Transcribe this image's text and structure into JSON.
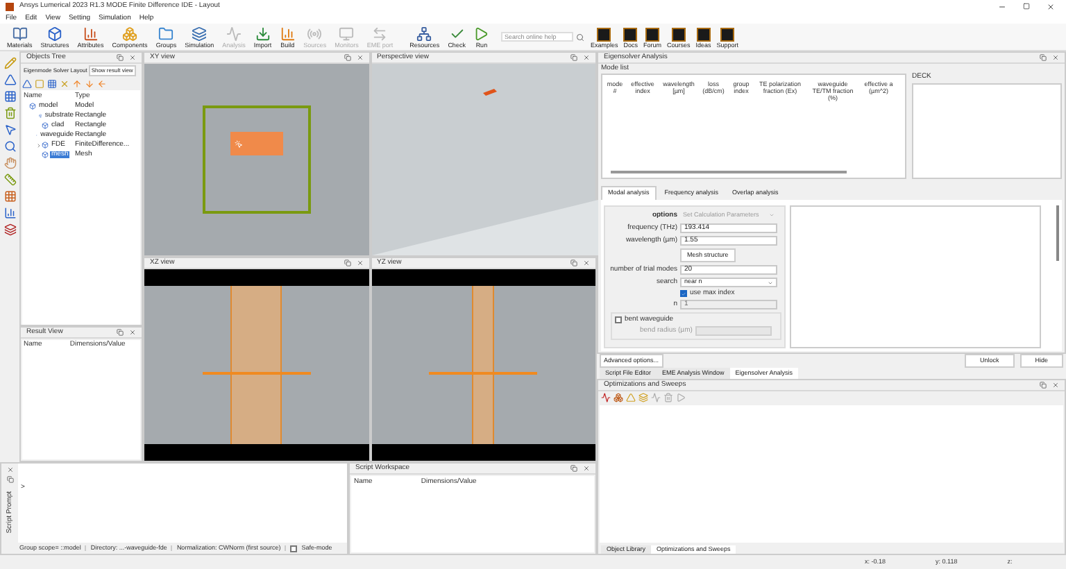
{
  "window": {
    "title": "Ansys Lumerical 2023 R1.3 MODE Finite Difference IDE - Layout"
  },
  "menu": [
    "File",
    "Edit",
    "View",
    "Setting",
    "Simulation",
    "Help"
  ],
  "toolbar": [
    {
      "label": "Materials",
      "disabled": false
    },
    {
      "label": "Structures",
      "disabled": false
    },
    {
      "label": "Attributes",
      "disabled": false
    },
    {
      "label": "Components",
      "disabled": false
    },
    {
      "label": "Groups",
      "disabled": false
    },
    {
      "label": "Simulation",
      "disabled": false
    },
    {
      "label": "Analysis",
      "disabled": true
    },
    {
      "label": "Import",
      "disabled": false
    },
    {
      "label": "Build",
      "disabled": false
    },
    {
      "label": "Sources",
      "disabled": true
    },
    {
      "label": "Monitors",
      "disabled": true
    },
    {
      "label": "EME port",
      "disabled": true
    },
    {
      "label": "Resources",
      "disabled": false
    },
    {
      "label": "Check",
      "disabled": false
    },
    {
      "label": "Run",
      "disabled": false
    }
  ],
  "search": {
    "placeholder": "Search online help"
  },
  "help_links": [
    "Examples",
    "Docs",
    "Forum",
    "Courses",
    "Ideas",
    "Support"
  ],
  "objects_tree": {
    "title": "Objects Tree",
    "tabs": [
      {
        "label": "Eigenmode Solver Layout",
        "selected": true
      },
      {
        "label": "Show result view",
        "selected": false
      }
    ],
    "columns": [
      "Name",
      "Type"
    ],
    "items": [
      {
        "name": "model",
        "type": "Model",
        "selected": false,
        "children": [
          {
            "name": "substrate",
            "type": "Rectangle",
            "selected": false
          },
          {
            "name": "clad",
            "type": "Rectangle",
            "selected": false
          },
          {
            "name": "waveguide",
            "type": "Rectangle",
            "selected": false
          },
          {
            "name": "FDE",
            "type": "FiniteDifference...",
            "selected": false,
            "expanded": false
          },
          {
            "name": "mesh",
            "type": "Mesh",
            "selected": true
          }
        ]
      }
    ]
  },
  "result_view": {
    "title": "Result View",
    "columns": [
      "Name",
      "Dimensions/Value"
    ]
  },
  "views": [
    {
      "title": "XY view",
      "kind": "xy"
    },
    {
      "title": "Perspective view",
      "kind": "perspective"
    },
    {
      "title": "XZ view",
      "kind": "xz"
    },
    {
      "title": "YZ view",
      "kind": "yz"
    }
  ],
  "script_prompt": {
    "title": "Script Prompt",
    "prompt": ">",
    "status": [
      "Group scope= ::model",
      "Directory: ...-waveguide-fde",
      "Normalization: CWNorm (first source)"
    ],
    "safe_mode": {
      "label": "Safe-mode",
      "checked": false
    }
  },
  "script_workspace": {
    "title": "Script Workspace",
    "columns": [
      "Name",
      "Dimensions/Value"
    ]
  },
  "eigensolver": {
    "title": "Eigensolver Analysis",
    "mode_list_title": "Mode list",
    "columns": [
      "mode #",
      "effective index",
      "wavelength [µm]",
      "loss (dB/cm)",
      "group index",
      "TE polarization fraction (Ex)",
      "waveguide TE/TM fraction (%)",
      "effective a (µm^2)"
    ],
    "deck_title": "DECK",
    "tabs": [
      {
        "label": "Modal analysis",
        "selected": true
      },
      {
        "label": "Frequency analysis",
        "selected": false
      },
      {
        "label": "Overlap analysis",
        "selected": false
      }
    ],
    "options": {
      "label": "options",
      "value": "Set Calculation Parameters"
    },
    "frequency": {
      "label": "frequency (THz)",
      "value": "193.414"
    },
    "wavelength": {
      "label": "wavelength (µm)",
      "value": "1.55"
    },
    "mesh_button": "Mesh structure",
    "trial_modes": {
      "label": "number of trial modes",
      "value": "20"
    },
    "search": {
      "label": "search",
      "value": "near n"
    },
    "use_max_index": {
      "label": "use max index",
      "checked": true
    },
    "n": {
      "label": "n",
      "value": "1"
    },
    "bent_waveguide": {
      "label": "bent waveguide",
      "checked": false
    },
    "bend_radius": {
      "label": "bend radius (µm)"
    },
    "advanced": "Advanced options...",
    "unlock": "Unlock",
    "hide": "Hide"
  },
  "dock_tabs": [
    {
      "label": "Script File Editor",
      "selected": false
    },
    {
      "label": "EME Analysis Window",
      "selected": false
    },
    {
      "label": "Eigensolver Analysis",
      "selected": true
    }
  ],
  "optimizations": {
    "title": "Optimizations and Sweeps"
  },
  "bottom_tabs": [
    {
      "label": "Object Library",
      "selected": false
    },
    {
      "label": "Optimizations and Sweeps",
      "selected": true
    }
  ],
  "status_bar": [
    "x: -0.18",
    "y: 0.118",
    "z:"
  ]
}
